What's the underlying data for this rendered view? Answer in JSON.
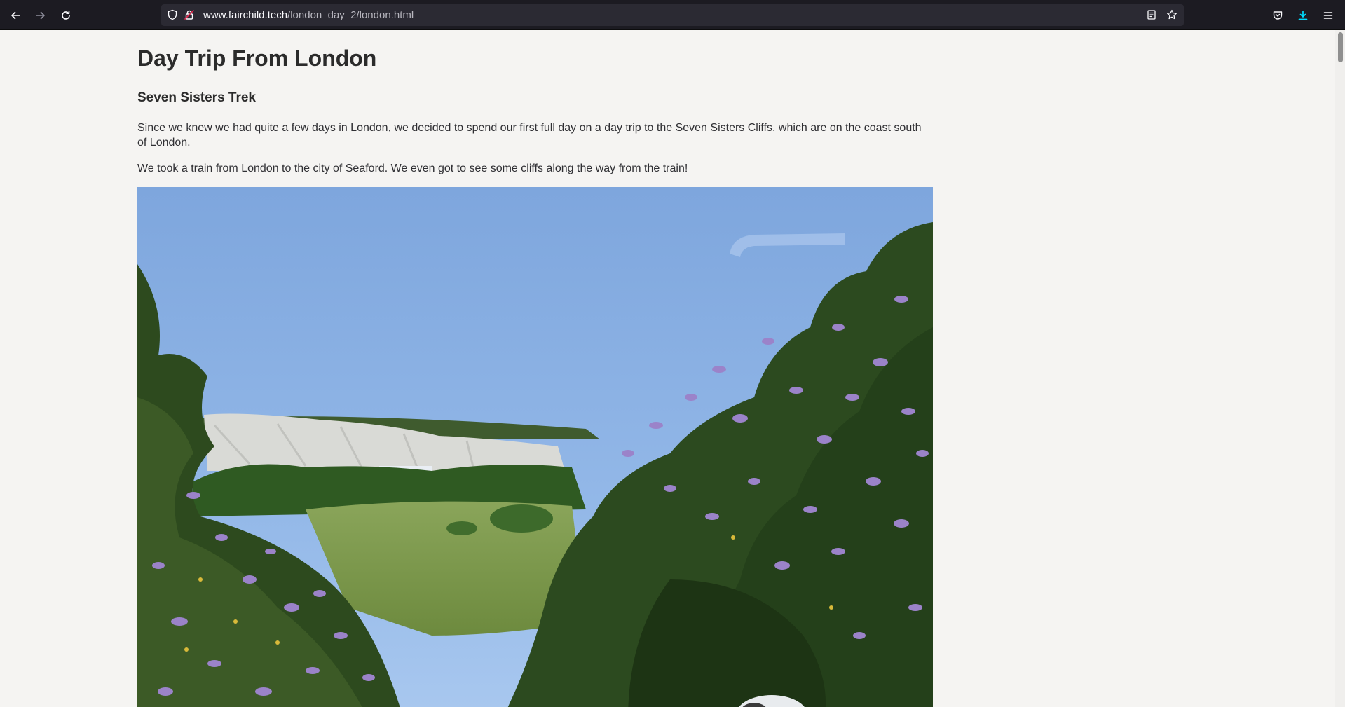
{
  "browser": {
    "url_domain": "www.fairchild.tech",
    "url_path": "/london_day_2/london.html",
    "icons": {
      "back": "back-arrow-icon",
      "forward": "forward-arrow-icon",
      "reload": "reload-icon",
      "tracking": "shield-icon",
      "lock": "lock-icon",
      "reader": "reader-view-icon",
      "bookmark": "star-icon",
      "pocket": "pocket-icon",
      "downloads": "download-icon",
      "menu": "hamburger-menu-icon"
    },
    "accent_color": "#00ddff"
  },
  "page": {
    "title": "Day Trip From London",
    "section_heading": "Seven Sisters Trek",
    "paragraph_1": "Since we knew we had quite a few days in London, we decided to spend our first full day on a day trip to the Seven Sisters Cliffs, which are on the coast south of London.",
    "paragraph_2": "We took a train from London to the city of Seaford. We even got to see some cliffs along the way from the train!"
  }
}
